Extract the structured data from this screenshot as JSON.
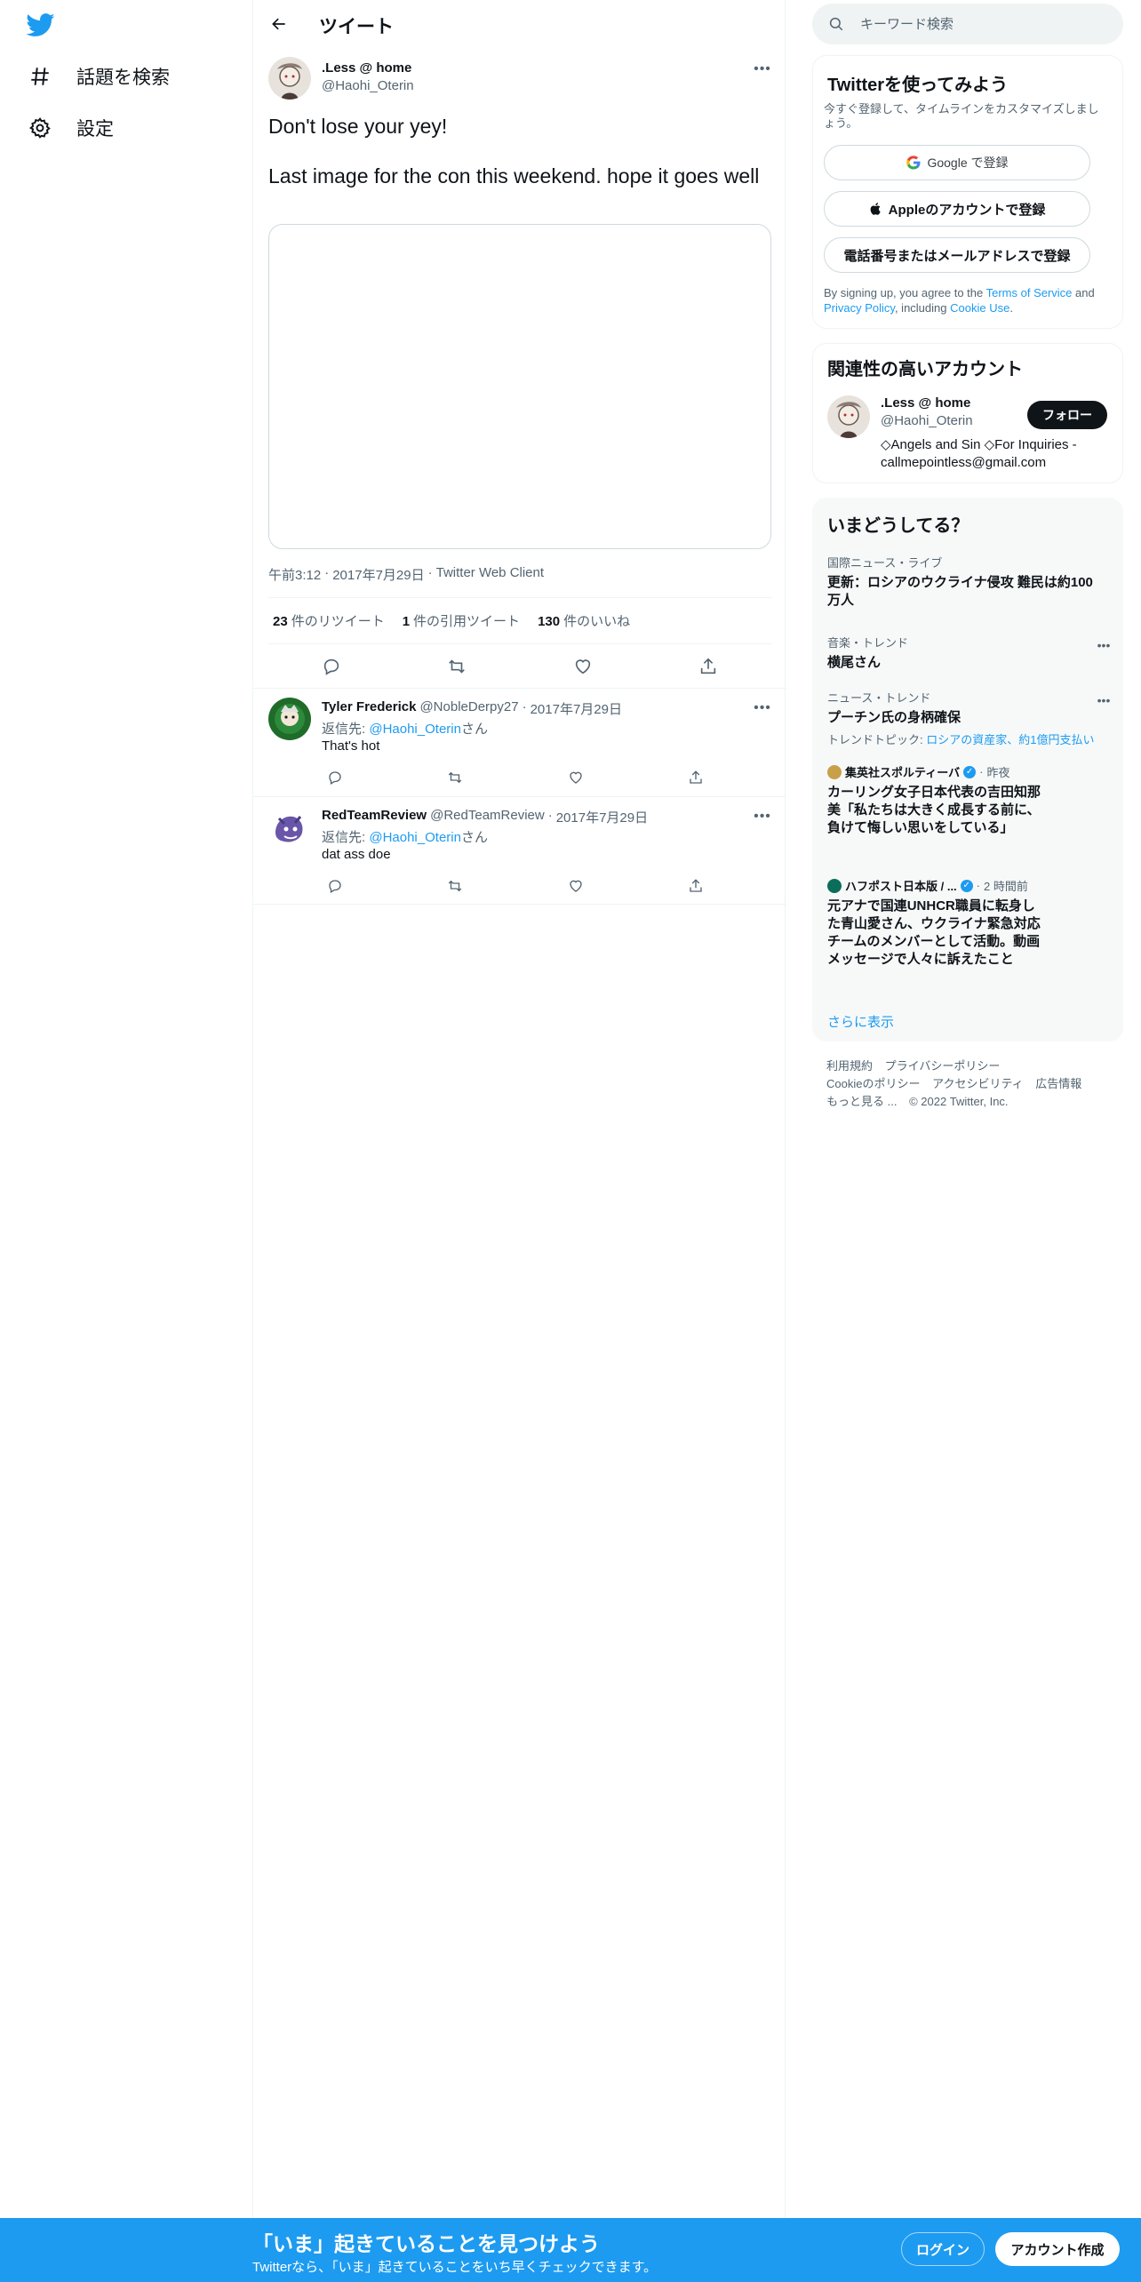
{
  "nav": {
    "items": [
      {
        "label": "話題を検索",
        "icon": "hashtag-icon"
      },
      {
        "label": "設定",
        "icon": "gear-icon"
      }
    ]
  },
  "header": {
    "title": "ツイート"
  },
  "tweet": {
    "author_name": ".Less @ home",
    "author_handle": "@Haohi_Oterin",
    "text_line1": "Don't lose your yey!",
    "text_line2": "Last image for the con this weekend. hope it goes well",
    "time": "午前3:12",
    "date": "2017年7月29日",
    "client": "Twitter Web Client",
    "sep": "·",
    "stats": {
      "retweets_count": "23",
      "retweets_label": "件のリツイート",
      "quotes_count": "1",
      "quotes_label": "件の引用ツイート",
      "likes_count": "130",
      "likes_label": "件のいいね"
    }
  },
  "replies": [
    {
      "name": "Tyler Frederick",
      "handle": "@NobleDerpy27",
      "sep": "·",
      "date": "2017年7月29日",
      "reply_prefix": "返信先: ",
      "reply_to": "@Haohi_Oterin",
      "reply_suffix": "さん",
      "text": "That's hot"
    },
    {
      "name": "RedTeamReview",
      "handle": "@RedTeamReview",
      "sep": "·",
      "date": "2017年7月29日",
      "reply_prefix": "返信先: ",
      "reply_to": "@Haohi_Oterin",
      "reply_suffix": "さん",
      "text": "dat ass doe"
    }
  ],
  "search": {
    "placeholder": "キーワード検索"
  },
  "signup": {
    "title": "Twitterを使ってみよう",
    "subtitle": "今すぐ登録して、タイムラインをカスタマイズしましょう。",
    "google_label": "Google で登録",
    "apple_label": "Appleのアカウントで登録",
    "phone_label": "電話番号またはメールアドレスで登録",
    "terms_prefix": "By signing up, you agree to the ",
    "terms_link": "Terms of Service",
    "terms_and": " and ",
    "privacy_link": "Privacy Policy",
    "terms_including": ", including ",
    "cookie_link": "Cookie Use",
    "terms_end": "."
  },
  "related": {
    "title": "関連性の高いアカウント",
    "name": ".Less @ home",
    "handle": "@Haohi_Oterin",
    "follow_label": "フォロー",
    "bio": "◇Angels and Sin ◇For Inquiries - callmepointless@gmail.com"
  },
  "trends": {
    "title": "いまどうしてる？",
    "items": [
      {
        "meta": "国際ニュース・ライブ",
        "title": "更新：ロシアのウクライナ侵攻 難民は約100万人"
      },
      {
        "meta": "音楽・トレンド",
        "title": "横尾さん"
      },
      {
        "meta": "ニュース・トレンド",
        "title": "プーチン氏の身柄確保",
        "topic_prefix": "トレンドトピック: ",
        "topic": "ロシアの資産家、約1億円支払い"
      }
    ],
    "news": [
      {
        "source": "集英社スポルティーバ",
        "time": "昨夜",
        "title": "カーリング女子日本代表の吉田知那美「私たちは大きく成長する前に、負けて悔しい思いをしている」"
      },
      {
        "source": "ハフポスト日本版 / ...",
        "time": "2 時間前",
        "title": "元アナで国連UNHCR職員に転身した青山愛さん、ウクライナ緊急対応チームのメンバーとして活動。動画メッセージで人々に訴えたこと"
      }
    ],
    "sep": "·",
    "show_more": "さらに表示"
  },
  "footer": {
    "terms": "利用規約",
    "privacy": "プライバシーポリシー",
    "cookie": "Cookieのポリシー",
    "accessibility": "アクセシビリティ",
    "ads": "広告情報",
    "more": "もっと見る ...",
    "copyright": "© 2022 Twitter, Inc."
  },
  "bottom_bar": {
    "title": "「いま」起きていることを見つけよう",
    "subtitle": "Twitterなら、「いま」起きていることをいち早くチェックできます。",
    "login_label": "ログイン",
    "signup_label": "アカウント作成"
  },
  "colors": {
    "accent": "#1d9bf0",
    "text": "#0f1419",
    "muted": "#536471"
  }
}
